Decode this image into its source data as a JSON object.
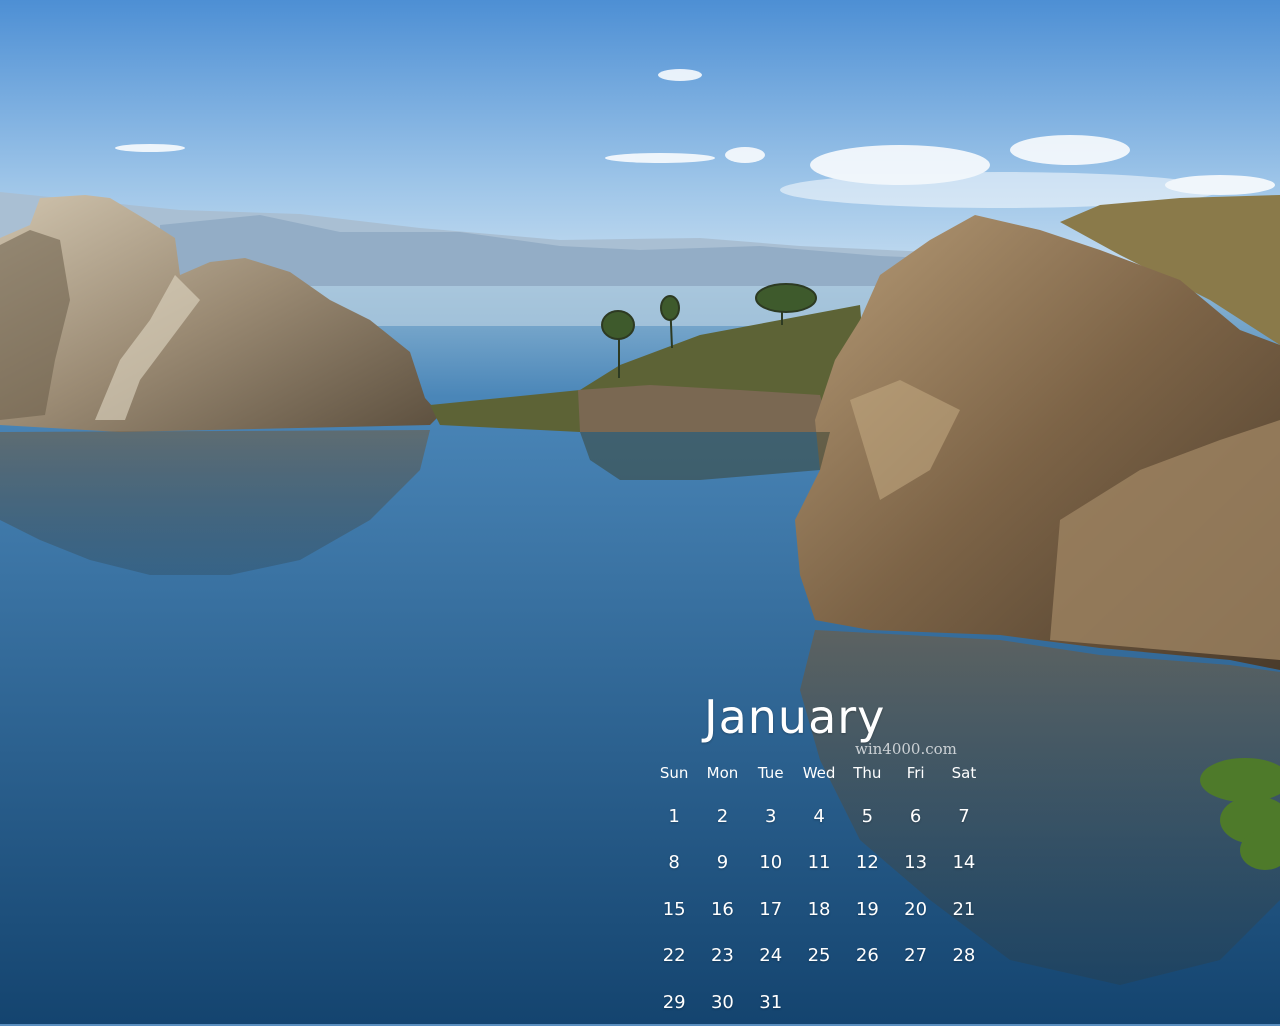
{
  "calendar": {
    "month": "January",
    "watermark": "win4000.com",
    "weekdays": [
      "Sun",
      "Mon",
      "Tue",
      "Wed",
      "Thu",
      "Fri",
      "Sat"
    ],
    "days": [
      "1",
      "2",
      "3",
      "4",
      "5",
      "6",
      "7",
      "8",
      "9",
      "10",
      "11",
      "12",
      "13",
      "14",
      "15",
      "16",
      "17",
      "18",
      "19",
      "20",
      "21",
      "22",
      "23",
      "24",
      "25",
      "26",
      "27",
      "28",
      "29",
      "30",
      "31"
    ]
  },
  "colors": {
    "sky_top": "#4d8fd4",
    "sky_bottom": "#cfe3f2",
    "lake_top": "#4a86b8",
    "lake_bottom": "#14446f",
    "rock": "#8a7358",
    "grass": "#5d6336",
    "text": "#ffffff"
  }
}
